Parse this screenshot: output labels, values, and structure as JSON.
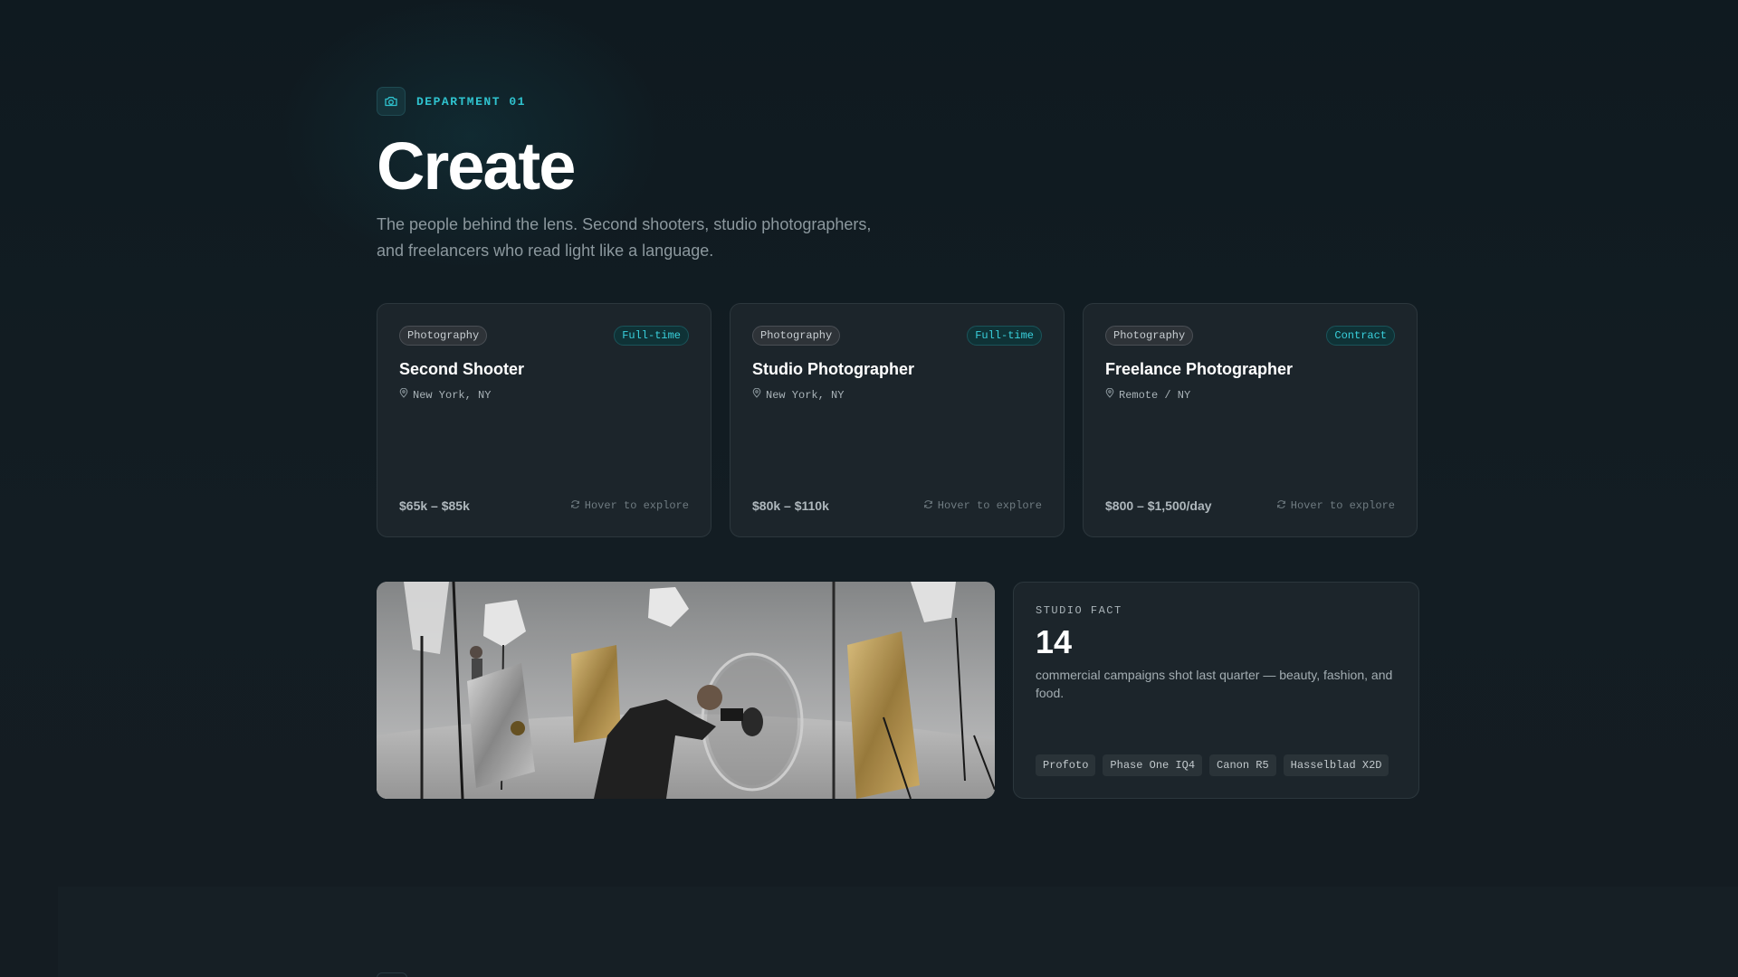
{
  "header": {
    "department_label": "DEPARTMENT 01",
    "department_icon": "camera-icon",
    "title": "Create",
    "subtitle": "The people behind the lens. Second shooters, studio photographers, and freelancers who read light like a language."
  },
  "jobs": [
    {
      "category": "Photography",
      "type": "Full-time",
      "title": "Second Shooter",
      "location": "New York, NY",
      "salary": "$65k – $85k",
      "hint": "Hover to explore"
    },
    {
      "category": "Photography",
      "type": "Full-time",
      "title": "Studio Photographer",
      "location": "New York, NY",
      "salary": "$80k – $110k",
      "hint": "Hover to explore"
    },
    {
      "category": "Photography",
      "type": "Contract",
      "title": "Freelance Photographer",
      "location": "Remote / NY",
      "salary": "$800 – $1,500/day",
      "hint": "Hover to explore"
    }
  ],
  "studio_fact": {
    "label": "STUDIO FACT",
    "number": "14",
    "description": "commercial campaigns shot last quarter — beauty, fashion, and food.",
    "equipment": [
      "Profoto",
      "Phase One IQ4",
      "Canon R5",
      "Hasselblad X2D"
    ]
  },
  "colors": {
    "accent": "#2fc3cf",
    "background": "#111a20",
    "card": "#1c252b"
  }
}
